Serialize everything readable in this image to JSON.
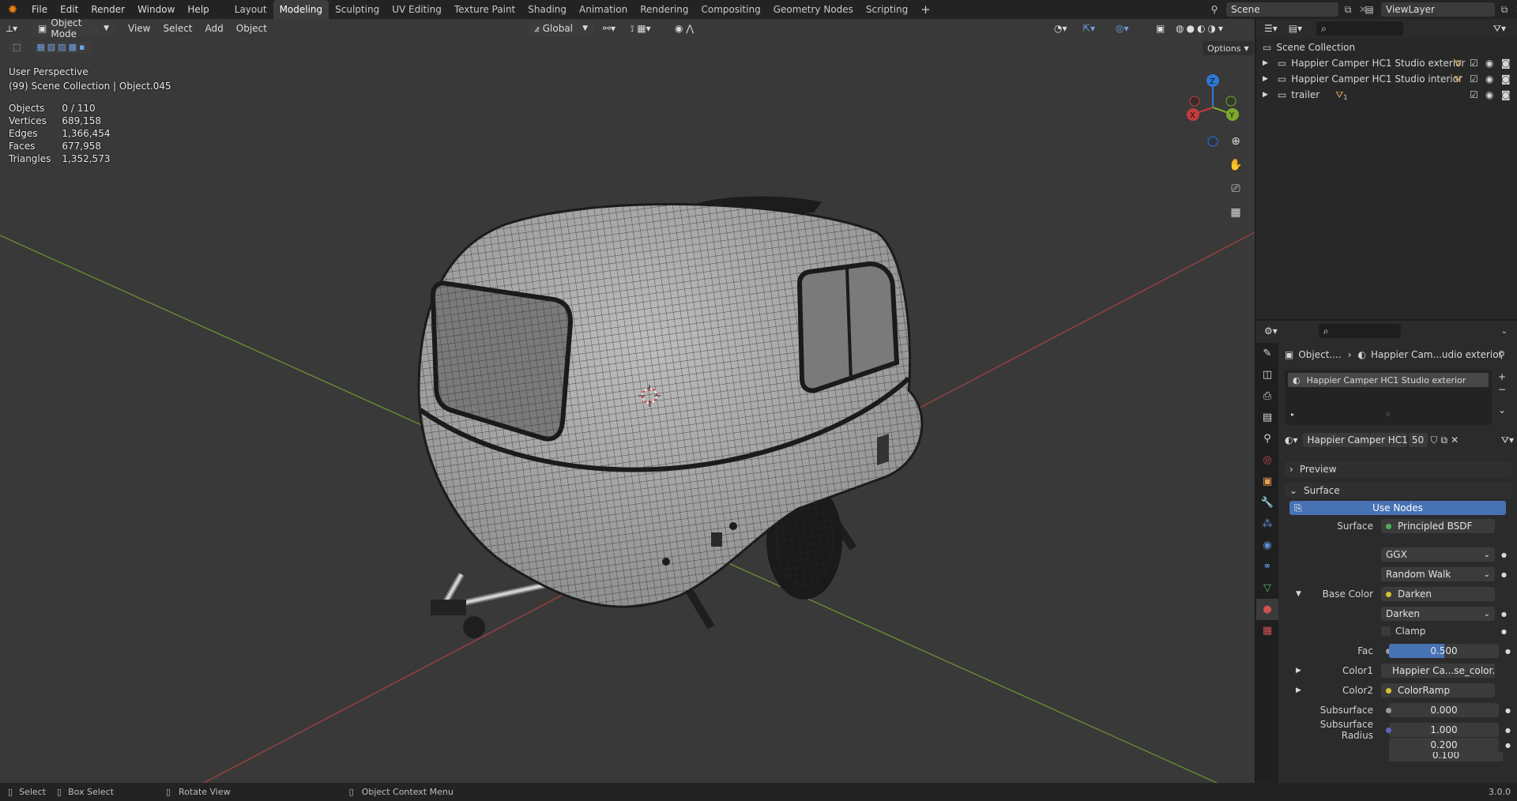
{
  "menu": [
    "File",
    "Edit",
    "Render",
    "Window",
    "Help"
  ],
  "workspaces": [
    "Layout",
    "Modeling",
    "Sculpting",
    "UV Editing",
    "Texture Paint",
    "Shading",
    "Animation",
    "Rendering",
    "Compositing",
    "Geometry Nodes",
    "Scripting"
  ],
  "active_workspace": "Modeling",
  "scene_name": "Scene",
  "viewlayer_name": "ViewLayer",
  "viewport": {
    "mode": "Object Mode",
    "menus": [
      "View",
      "Select",
      "Add",
      "Object"
    ],
    "orientation": "Global",
    "options": "Options",
    "perspective": "User Perspective",
    "collection_info": "(99) Scene Collection | Object.045",
    "stats": [
      {
        "label": "Objects",
        "value": "0 / 110"
      },
      {
        "label": "Vertices",
        "value": "689,158"
      },
      {
        "label": "Edges",
        "value": "1,366,454"
      },
      {
        "label": "Faces",
        "value": "677,958"
      },
      {
        "label": "Triangles",
        "value": "1,352,573"
      }
    ],
    "gizmo": {
      "x": "X",
      "y": "Y",
      "z": "Z"
    }
  },
  "outliner": {
    "root": "Scene Collection",
    "items": [
      {
        "label": "Happier Camper HC1 Studio  exterior"
      },
      {
        "label": "Happier Camper HC1 Studio  interior"
      },
      {
        "label": "trailer",
        "badge": "1"
      }
    ]
  },
  "properties": {
    "breadcrumb_object": "Object....",
    "breadcrumb_material": "Happier Cam...udio  exterior",
    "slot": "Happier Camper HC1 Studio  exterior",
    "material_name": "Happier Camper HC1 ...",
    "users": "50",
    "panels": {
      "preview": "Preview",
      "surface": "Surface"
    },
    "use_nodes": "Use Nodes",
    "rows": [
      {
        "label": "Surface",
        "value": "Principled BSDF",
        "dot": "#4caf50"
      },
      {
        "label": "",
        "value": "GGX",
        "dropdown": true
      },
      {
        "label": "",
        "value": "Random Walk",
        "dropdown": true
      },
      {
        "label": "Base Color",
        "value": "Darken",
        "dot": "#d4c22e",
        "expand": "▾"
      },
      {
        "label": "",
        "value": "Darken",
        "dropdown": true
      },
      {
        "label": "",
        "value": "Clamp",
        "checkbox": true
      },
      {
        "label": "Fac",
        "value": "0.500",
        "dot": "#9a9a9a",
        "slider": 0.5
      },
      {
        "label": "Color1",
        "value": "Happier Ca...se_color.png",
        "dot": "#d4c22e",
        "expand": "▸"
      },
      {
        "label": "Color2",
        "value": "ColorRamp",
        "dot": "#d4c22e",
        "expand": "▸"
      },
      {
        "label": "Subsurface",
        "value": "0.000",
        "dot": "#9a9a9a",
        "center": true
      },
      {
        "label": "Subsurface Radius",
        "value": "1.000",
        "dot": "#6363c7",
        "center": true
      },
      {
        "label": "",
        "value": "0.200",
        "center": true
      },
      {
        "label": "",
        "value": "0.100",
        "center": true
      }
    ]
  },
  "statusbar": {
    "select": "Select",
    "box_select": "Box Select",
    "rotate": "Rotate View",
    "context": "Object Context Menu",
    "version": "3.0.0"
  },
  "colors": {
    "accent": "#4772b3",
    "x_axis": "#c43c3c",
    "y_axis": "#7ea82b",
    "z_axis": "#2c78d6"
  }
}
